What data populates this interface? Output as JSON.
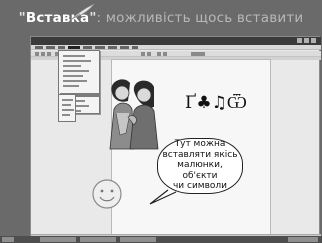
{
  "slide": {
    "title_keyword": "Вставка",
    "title_open_quote": "\"",
    "title_close_quote": "\"",
    "title_rest": ": можливість щось вставити"
  },
  "document": {
    "symbols": "Ґ♣♫Ѿ",
    "bubble_lines": [
      "Тут можна",
      "вставляти якісь",
      "малюнки,",
      "об'єкти",
      "чи символи"
    ]
  },
  "icons": {
    "quill": "quill-pen-icon",
    "smiley": "smiley-face-icon",
    "clipart": "two-people-clipart"
  },
  "colors": {
    "background": "#6a6a6a",
    "title_text": "#b8b8b8",
    "keyword": "#ffffff"
  }
}
